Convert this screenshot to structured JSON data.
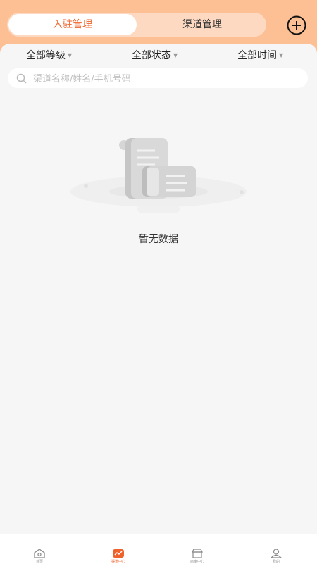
{
  "header": {
    "tabs": [
      {
        "label": "入驻管理",
        "active": true
      },
      {
        "label": "渠道管理",
        "active": false
      }
    ]
  },
  "filters": [
    {
      "label": "全部等级"
    },
    {
      "label": "全部状态"
    },
    {
      "label": "全部时间"
    }
  ],
  "search": {
    "placeholder": "渠道名称/姓名/手机号码",
    "value": ""
  },
  "empty": {
    "text": "暂无数据"
  },
  "tabbar": {
    "items": [
      {
        "label": "首页",
        "icon": "home-icon",
        "active": false
      },
      {
        "label": "渠道中心",
        "icon": "channel-icon",
        "active": true
      },
      {
        "label": "商家中心",
        "icon": "store-icon",
        "active": false
      },
      {
        "label": "我的",
        "icon": "user-icon",
        "active": false
      }
    ]
  },
  "colors": {
    "header_bg": "#fdbf94",
    "accent": "#f0622b",
    "page_bg": "#f6f6f6"
  }
}
